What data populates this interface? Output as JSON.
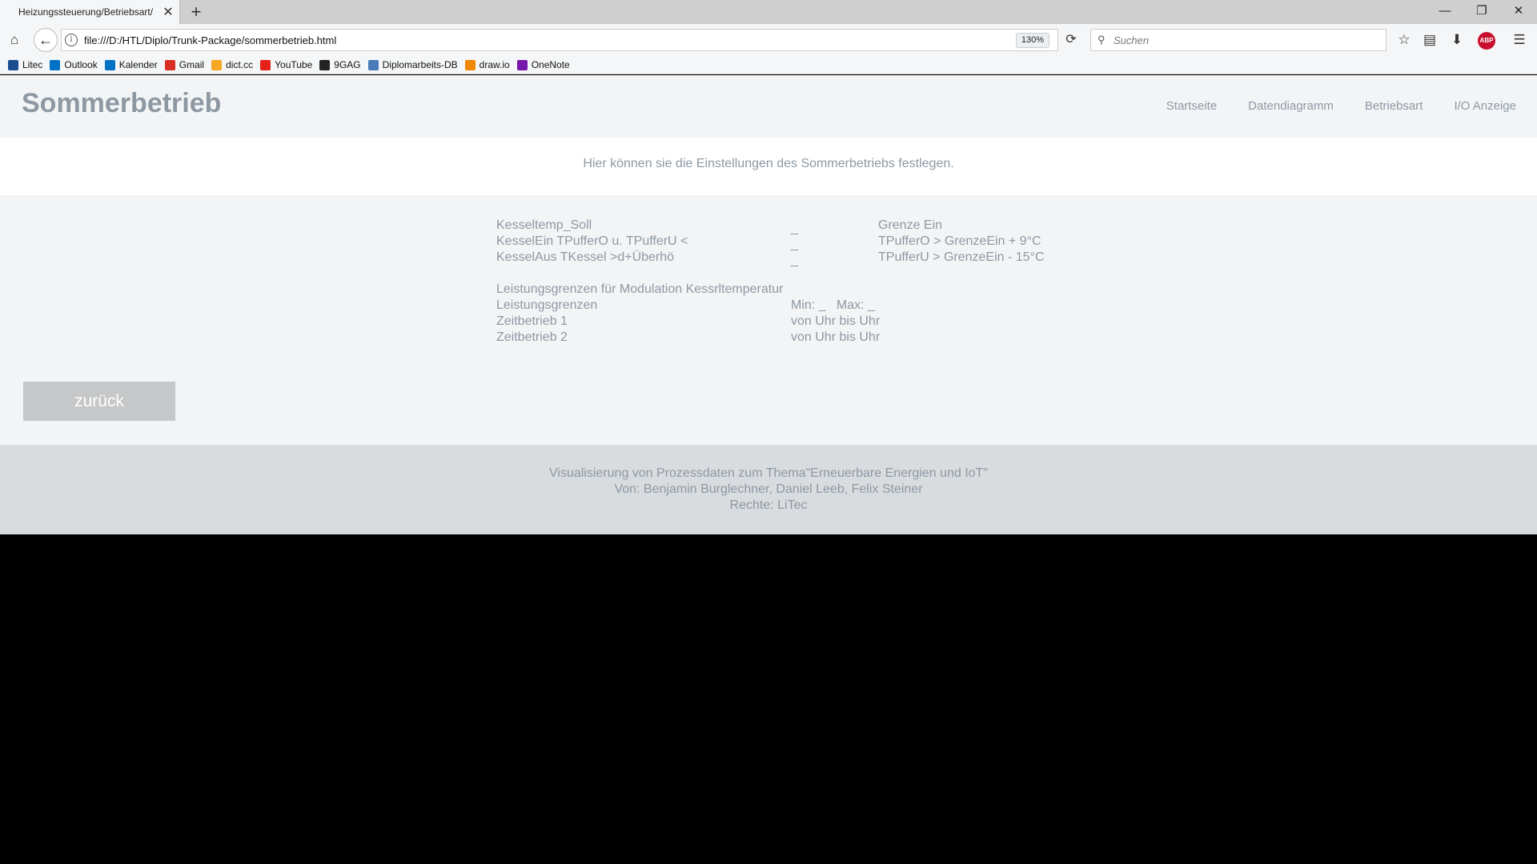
{
  "browser": {
    "tab_title": "Heizungssteuerung/Betriebsart/",
    "tab_close": "✕",
    "new_tab": "+",
    "url": "file:///D:/HTL/Diplo/Trunk-Package/sommerbetrieb.html",
    "zoom": "130%",
    "search_placeholder": "Suchen",
    "bookmarks": [
      "Litec",
      "Outlook",
      "Kalender",
      "Gmail",
      "dict.cc",
      "YouTube",
      "9GAG",
      "Diplomarbeits-DB",
      "draw.io",
      "OneNote"
    ],
    "bookmark_colors": [
      "#1a4d8f",
      "#0072c6",
      "#0072c6",
      "#d93025",
      "#f5a623",
      "#e62117",
      "#222222",
      "#4a7ab8",
      "#f08705",
      "#7719aa"
    ],
    "abp_label": "ABP"
  },
  "site": {
    "title": "Sommerbetrieb",
    "nav": [
      "Startseite",
      "Datendiagramm",
      "Betriebsart",
      "I/O Anzeige"
    ]
  },
  "intro": "Hier können sie die Einstellungen des Sommerbetriebs festlegen.",
  "settings": {
    "rows": [
      {
        "label": "Kesseltemp_Soll",
        "value": "_",
        "extra": "Grenze Ein"
      },
      {
        "label": "KesselEin TPufferO u. TPufferU <",
        "value": "_",
        "extra": "TPufferO > GrenzeEin + 9°C"
      },
      {
        "label": "KesselAus TKessel >d+Überhö",
        "value": "_",
        "extra": "TPufferU > GrenzeEin - 15°C"
      }
    ],
    "modulation_heading": "Leistungsgrenzen für Modulation Kessrltemperatur",
    "rows2": [
      {
        "label": "Leistungsgrenzen",
        "value": "Min: _   Max: _"
      },
      {
        "label": "Zeitbetrieb 1",
        "value": "von Uhr bis Uhr"
      },
      {
        "label": "Zeitbetrieb 2",
        "value": "von Uhr bis Uhr"
      }
    ]
  },
  "back_button": "zurück",
  "footer": {
    "line1": "Visualisierung von Prozessdaten zum Thema\"Erneuerbare Energien und IoT\"",
    "line2": "Von: Benjamin Burglechner, Daniel Leeb, Felix Steiner",
    "line3": "Rechte: LiTec"
  }
}
